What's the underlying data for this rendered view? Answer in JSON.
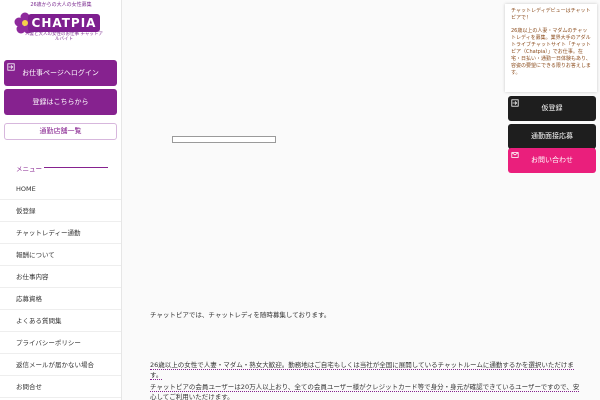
{
  "logo": {
    "tagline": "26歳からの大人の女性募集",
    "name": "CHATPIA",
    "sub": "人妻と大人の女性のお仕事 チャットアルバイト"
  },
  "sidebar": {
    "job_page_button": "お仕事ページへログイン",
    "register_button": "登録はこちらから",
    "stores_button": "通勤店舗一覧",
    "menu_title": "メニュー",
    "items": [
      {
        "label": "HOME"
      },
      {
        "label": "仮登録"
      },
      {
        "label": "チャットレディー通勤"
      },
      {
        "label": "報酬について"
      },
      {
        "label": "お仕事内容"
      },
      {
        "label": "応募資格"
      },
      {
        "label": "よくある質問集"
      },
      {
        "label": "プライバシーポリシー"
      },
      {
        "label": "返信メールが届かない場合"
      },
      {
        "label": "お問合せ"
      }
    ]
  },
  "notice": {
    "head": "チャットレディデビューはチャットピアで！",
    "body": "26歳以上の人妻・マダムのチャットレディを募集。業界大手のアダルトライブチャットサイト「チャットピア（Chatpia）」でお仕事。在宅・日払い・通勤ー日体験もあり、容姿の要望にできる限りお答えします。"
  },
  "float_buttons": {
    "register": "仮登録",
    "interview": "通勤面接応募",
    "contact": "お問い合わせ"
  },
  "content": {
    "p1": "チャットピアでは、チャットレディを随時募集しております。",
    "p2": "26歳以上の女性で人妻・マダム・熟女大歓迎。勤務地はご自宅もしくは当社が全国に展開しているチャットルームに通勤するかを選択いただけます。",
    "p3": "チャットピアの会員ユーザーは20万人以上おり、全ての会員ユーザー様がクレジットカード等で身分・身元が確認できているユーザーですので、安心してご利用いただけます。"
  },
  "colors": {
    "brand_purple": "#86228f",
    "dark_button": "#1e1e1e",
    "pink_button": "#ea1f7c"
  }
}
